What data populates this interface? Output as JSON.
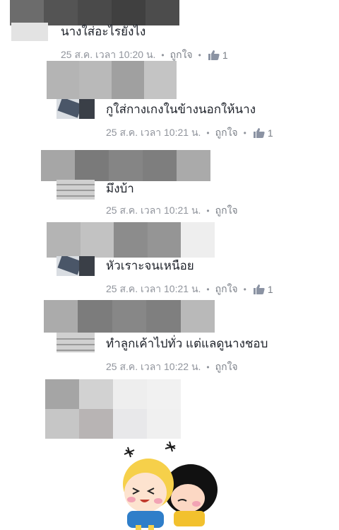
{
  "comments": [
    {
      "text": "นางใส่อะไรยังไง",
      "time": "25 ส.ค. เวลา 10:20 น.",
      "like_label": "ถูกใจ",
      "likes": "1"
    },
    {
      "text": "กูใส่กางเกงในข้างนอกให้นาง",
      "time": "25 ส.ค. เวลา 10:21 น.",
      "like_label": "ถูกใจ",
      "likes": "1"
    },
    {
      "text": "มึงบ้า",
      "time": "25 ส.ค. เวลา 10:21 น.",
      "like_label": "ถูกใจ"
    },
    {
      "text": "หัวเราะจนเหนือย",
      "time": "25 ส.ค. เวลา 10:21 น.",
      "like_label": "ถูกใจ",
      "likes": "1"
    },
    {
      "text": "ทำลูกเค้าไปทั่ว แต่แลดูนางชอบ",
      "time": "25 ส.ค. เวลา 10:22 น.",
      "like_label": "ถูกใจ"
    }
  ],
  "icons": {
    "like": "thumbs-up-icon",
    "separator": "dot"
  },
  "colors": {
    "meta_text": "#90949c",
    "like_icon": "#8b93a3",
    "body_text": "#1d2129"
  }
}
